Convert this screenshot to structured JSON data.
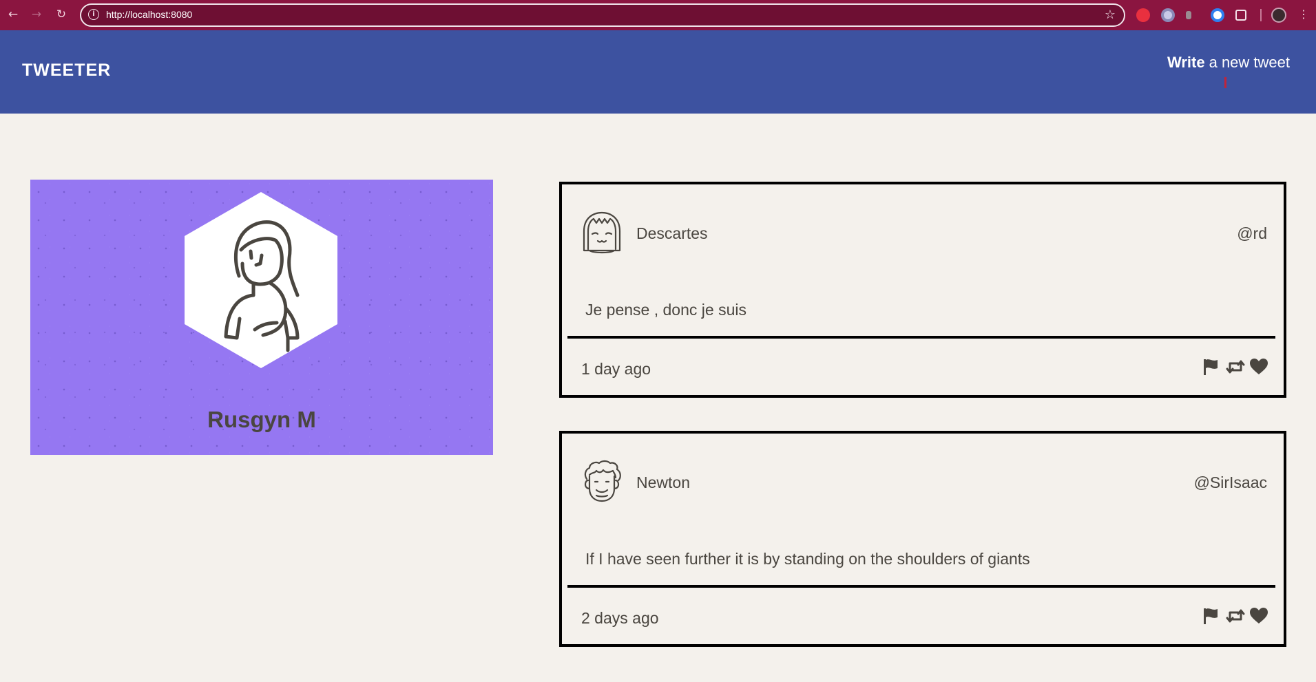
{
  "browser": {
    "url": "http://localhost:8080",
    "icons": [
      "back-arrow-icon",
      "forward-arrow-icon",
      "reload-icon",
      "site-info-icon",
      "bookmark-star-icon",
      "extension-icon",
      "menu-kebab-icon"
    ]
  },
  "header": {
    "logo": "TWEETER",
    "write_bold": "Write",
    "write_rest": "a new tweet",
    "background": "#3d52a0"
  },
  "profile": {
    "name": "Rusgyn M",
    "background": "#9577f2",
    "avatar_icon": "woman-avatar-icon"
  },
  "tweets": [
    {
      "name": "Descartes",
      "handle": "@rd",
      "text": "Je pense , donc je suis",
      "time": "1 day ago",
      "avatar_icon": "bob-haircut-face-icon"
    },
    {
      "name": "Newton",
      "handle": "@SirIsaac",
      "text": "If I have seen further it is by standing on the shoulders of giants",
      "time": "2 days ago",
      "avatar_icon": "curly-hair-face-icon"
    }
  ],
  "actions": [
    "flag-icon",
    "retweet-icon",
    "heart-icon"
  ]
}
